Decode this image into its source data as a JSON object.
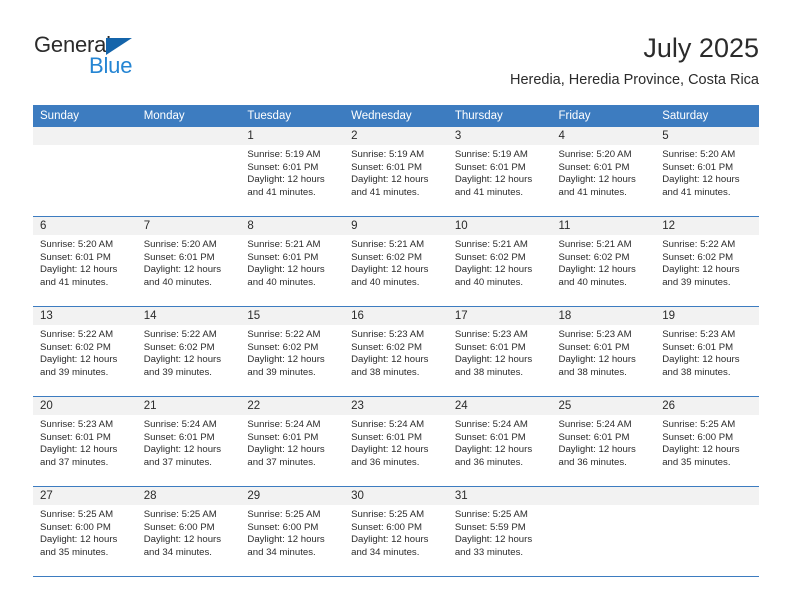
{
  "brand": {
    "name_top": "General",
    "name_bottom": "Blue",
    "logo_color": "#1464aa",
    "blue_text_color": "#2585d3"
  },
  "header": {
    "title": "July 2025",
    "subtitle": "Heredia, Heredia Province, Costa Rica"
  },
  "theme": {
    "header_blue": "#3d7cc0",
    "band_gray": "#f2f2f2",
    "text": "#2b2b2b"
  },
  "weekdays": [
    "Sunday",
    "Monday",
    "Tuesday",
    "Wednesday",
    "Thursday",
    "Friday",
    "Saturday"
  ],
  "labels": {
    "sunrise_prefix": "Sunrise:",
    "sunset_prefix": "Sunset:",
    "daylight_prefix": "Daylight:"
  },
  "weeks": [
    [
      {
        "day": "",
        "sunrise": "",
        "sunset": "",
        "daylight_1": "",
        "daylight_2": ""
      },
      {
        "day": "",
        "sunrise": "",
        "sunset": "",
        "daylight_1": "",
        "daylight_2": ""
      },
      {
        "day": "1",
        "sunrise": "Sunrise: 5:19 AM",
        "sunset": "Sunset: 6:01 PM",
        "daylight_1": "Daylight: 12 hours",
        "daylight_2": "and 41 minutes."
      },
      {
        "day": "2",
        "sunrise": "Sunrise: 5:19 AM",
        "sunset": "Sunset: 6:01 PM",
        "daylight_1": "Daylight: 12 hours",
        "daylight_2": "and 41 minutes."
      },
      {
        "day": "3",
        "sunrise": "Sunrise: 5:19 AM",
        "sunset": "Sunset: 6:01 PM",
        "daylight_1": "Daylight: 12 hours",
        "daylight_2": "and 41 minutes."
      },
      {
        "day": "4",
        "sunrise": "Sunrise: 5:20 AM",
        "sunset": "Sunset: 6:01 PM",
        "daylight_1": "Daylight: 12 hours",
        "daylight_2": "and 41 minutes."
      },
      {
        "day": "5",
        "sunrise": "Sunrise: 5:20 AM",
        "sunset": "Sunset: 6:01 PM",
        "daylight_1": "Daylight: 12 hours",
        "daylight_2": "and 41 minutes."
      }
    ],
    [
      {
        "day": "6",
        "sunrise": "Sunrise: 5:20 AM",
        "sunset": "Sunset: 6:01 PM",
        "daylight_1": "Daylight: 12 hours",
        "daylight_2": "and 41 minutes."
      },
      {
        "day": "7",
        "sunrise": "Sunrise: 5:20 AM",
        "sunset": "Sunset: 6:01 PM",
        "daylight_1": "Daylight: 12 hours",
        "daylight_2": "and 40 minutes."
      },
      {
        "day": "8",
        "sunrise": "Sunrise: 5:21 AM",
        "sunset": "Sunset: 6:01 PM",
        "daylight_1": "Daylight: 12 hours",
        "daylight_2": "and 40 minutes."
      },
      {
        "day": "9",
        "sunrise": "Sunrise: 5:21 AM",
        "sunset": "Sunset: 6:02 PM",
        "daylight_1": "Daylight: 12 hours",
        "daylight_2": "and 40 minutes."
      },
      {
        "day": "10",
        "sunrise": "Sunrise: 5:21 AM",
        "sunset": "Sunset: 6:02 PM",
        "daylight_1": "Daylight: 12 hours",
        "daylight_2": "and 40 minutes."
      },
      {
        "day": "11",
        "sunrise": "Sunrise: 5:21 AM",
        "sunset": "Sunset: 6:02 PM",
        "daylight_1": "Daylight: 12 hours",
        "daylight_2": "and 40 minutes."
      },
      {
        "day": "12",
        "sunrise": "Sunrise: 5:22 AM",
        "sunset": "Sunset: 6:02 PM",
        "daylight_1": "Daylight: 12 hours",
        "daylight_2": "and 39 minutes."
      }
    ],
    [
      {
        "day": "13",
        "sunrise": "Sunrise: 5:22 AM",
        "sunset": "Sunset: 6:02 PM",
        "daylight_1": "Daylight: 12 hours",
        "daylight_2": "and 39 minutes."
      },
      {
        "day": "14",
        "sunrise": "Sunrise: 5:22 AM",
        "sunset": "Sunset: 6:02 PM",
        "daylight_1": "Daylight: 12 hours",
        "daylight_2": "and 39 minutes."
      },
      {
        "day": "15",
        "sunrise": "Sunrise: 5:22 AM",
        "sunset": "Sunset: 6:02 PM",
        "daylight_1": "Daylight: 12 hours",
        "daylight_2": "and 39 minutes."
      },
      {
        "day": "16",
        "sunrise": "Sunrise: 5:23 AM",
        "sunset": "Sunset: 6:02 PM",
        "daylight_1": "Daylight: 12 hours",
        "daylight_2": "and 38 minutes."
      },
      {
        "day": "17",
        "sunrise": "Sunrise: 5:23 AM",
        "sunset": "Sunset: 6:01 PM",
        "daylight_1": "Daylight: 12 hours",
        "daylight_2": "and 38 minutes."
      },
      {
        "day": "18",
        "sunrise": "Sunrise: 5:23 AM",
        "sunset": "Sunset: 6:01 PM",
        "daylight_1": "Daylight: 12 hours",
        "daylight_2": "and 38 minutes."
      },
      {
        "day": "19",
        "sunrise": "Sunrise: 5:23 AM",
        "sunset": "Sunset: 6:01 PM",
        "daylight_1": "Daylight: 12 hours",
        "daylight_2": "and 38 minutes."
      }
    ],
    [
      {
        "day": "20",
        "sunrise": "Sunrise: 5:23 AM",
        "sunset": "Sunset: 6:01 PM",
        "daylight_1": "Daylight: 12 hours",
        "daylight_2": "and 37 minutes."
      },
      {
        "day": "21",
        "sunrise": "Sunrise: 5:24 AM",
        "sunset": "Sunset: 6:01 PM",
        "daylight_1": "Daylight: 12 hours",
        "daylight_2": "and 37 minutes."
      },
      {
        "day": "22",
        "sunrise": "Sunrise: 5:24 AM",
        "sunset": "Sunset: 6:01 PM",
        "daylight_1": "Daylight: 12 hours",
        "daylight_2": "and 37 minutes."
      },
      {
        "day": "23",
        "sunrise": "Sunrise: 5:24 AM",
        "sunset": "Sunset: 6:01 PM",
        "daylight_1": "Daylight: 12 hours",
        "daylight_2": "and 36 minutes."
      },
      {
        "day": "24",
        "sunrise": "Sunrise: 5:24 AM",
        "sunset": "Sunset: 6:01 PM",
        "daylight_1": "Daylight: 12 hours",
        "daylight_2": "and 36 minutes."
      },
      {
        "day": "25",
        "sunrise": "Sunrise: 5:24 AM",
        "sunset": "Sunset: 6:01 PM",
        "daylight_1": "Daylight: 12 hours",
        "daylight_2": "and 36 minutes."
      },
      {
        "day": "26",
        "sunrise": "Sunrise: 5:25 AM",
        "sunset": "Sunset: 6:00 PM",
        "daylight_1": "Daylight: 12 hours",
        "daylight_2": "and 35 minutes."
      }
    ],
    [
      {
        "day": "27",
        "sunrise": "Sunrise: 5:25 AM",
        "sunset": "Sunset: 6:00 PM",
        "daylight_1": "Daylight: 12 hours",
        "daylight_2": "and 35 minutes."
      },
      {
        "day": "28",
        "sunrise": "Sunrise: 5:25 AM",
        "sunset": "Sunset: 6:00 PM",
        "daylight_1": "Daylight: 12 hours",
        "daylight_2": "and 34 minutes."
      },
      {
        "day": "29",
        "sunrise": "Sunrise: 5:25 AM",
        "sunset": "Sunset: 6:00 PM",
        "daylight_1": "Daylight: 12 hours",
        "daylight_2": "and 34 minutes."
      },
      {
        "day": "30",
        "sunrise": "Sunrise: 5:25 AM",
        "sunset": "Sunset: 6:00 PM",
        "daylight_1": "Daylight: 12 hours",
        "daylight_2": "and 34 minutes."
      },
      {
        "day": "31",
        "sunrise": "Sunrise: 5:25 AM",
        "sunset": "Sunset: 5:59 PM",
        "daylight_1": "Daylight: 12 hours",
        "daylight_2": "and 33 minutes."
      },
      {
        "day": "",
        "sunrise": "",
        "sunset": "",
        "daylight_1": "",
        "daylight_2": ""
      },
      {
        "day": "",
        "sunrise": "",
        "sunset": "",
        "daylight_1": "",
        "daylight_2": ""
      }
    ]
  ]
}
